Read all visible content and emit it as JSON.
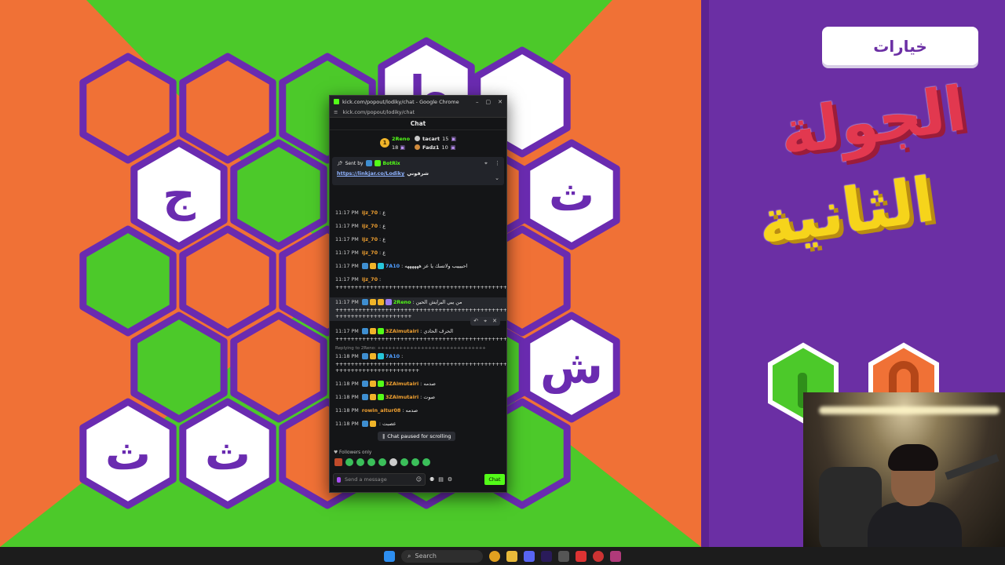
{
  "board": {
    "colors": {
      "orange": "#f07136",
      "green": "#4cc92a",
      "purple": "#6a2bb0",
      "white": "#ffffff"
    },
    "letters": [
      "ط",
      "ج",
      "ث",
      "ش",
      "ث",
      "ث"
    ]
  },
  "side": {
    "options_label": "خيارات",
    "round_line1": "الجولة",
    "round_line2": "الثانية"
  },
  "taskbar": {
    "search_label": "Search"
  },
  "chat": {
    "window_title": "kick.com/popout/lodiky/chat - Google Chrome",
    "url": "kick.com/popout/lodiky/chat",
    "header": "Chat",
    "leaderboard": [
      {
        "rank": "1",
        "name": "2Reno",
        "count": "18"
      },
      {
        "name": "tacart",
        "count": "15"
      },
      {
        "name": "Fadz1",
        "count": "10"
      }
    ],
    "pinned": {
      "sent_by": "Sent by",
      "bot": "BotRix",
      "text": "شرفوني",
      "link": "https://linkjar.co/Lodiky"
    },
    "messages": [
      {
        "time": "11:17 PM",
        "user": "ijz_70",
        "color": "#f0a030",
        "text": "ع"
      },
      {
        "time": "11:17 PM",
        "user": "ijz_70",
        "color": "#f0a030",
        "text": "ع"
      },
      {
        "time": "11:17 PM",
        "user": "ijz_70",
        "color": "#f0a030",
        "text": "ع"
      },
      {
        "time": "11:17 PM",
        "user": "ijz_70",
        "color": "#f0a030",
        "text": "ع"
      },
      {
        "time": "11:17 PM",
        "user": "7A10",
        "color": "#4f9dff",
        "text": "احبيييب ولاتسك يا عز ههههههه"
      },
      {
        "time": "11:17 PM",
        "user": "ijz_70",
        "color": "#f0a030",
        "text": "",
        "cont": "++++++++++++++++++++++++++++++++++++++++++++++++++++++++"
      },
      {
        "time": "11:17 PM",
        "user": "2Reno",
        "color": "#53fc18",
        "text": "من يبي البرايش الحين",
        "cont": "++++++++++++++++++++++++++++++++++++++++++++++++++++++++ ++++++++++++++++++++"
      },
      {
        "time": "11:17 PM",
        "user": "3ZAlmutairi",
        "color": "#f0a030",
        "text": "الحرف الحادي",
        "cont": "++++++++++++++++++++++++++++++++++++++++++++++"
      },
      {
        "time": "11:18 PM",
        "user": "7A10",
        "color": "#4f9dff",
        "text": "",
        "reply": "Replying to 2Reno: ++++++++++++++++++++++++++++++",
        "cont": "++++++++++++++++++++++++++++++++++++++++++++++++++++++ ++++++++++++++++++++++"
      },
      {
        "time": "11:18 PM",
        "user": "3ZAlmutairi",
        "color": "#f0a030",
        "text": "صدمه"
      },
      {
        "time": "11:18 PM",
        "user": "3ZAlmutairi",
        "color": "#f0a030",
        "text": "صوت"
      },
      {
        "time": "11:18 PM",
        "user": "rowin_altur08",
        "color": "#f0a030",
        "text": "صدمه"
      },
      {
        "time": "11:18 PM",
        "user": "",
        "color": "#f0a030",
        "text": "عصبت"
      }
    ],
    "paused_label": "Chat paused for scrolling",
    "followers_only": "Followers only",
    "input_placeholder": "Send a message",
    "send_label": "Chat"
  }
}
